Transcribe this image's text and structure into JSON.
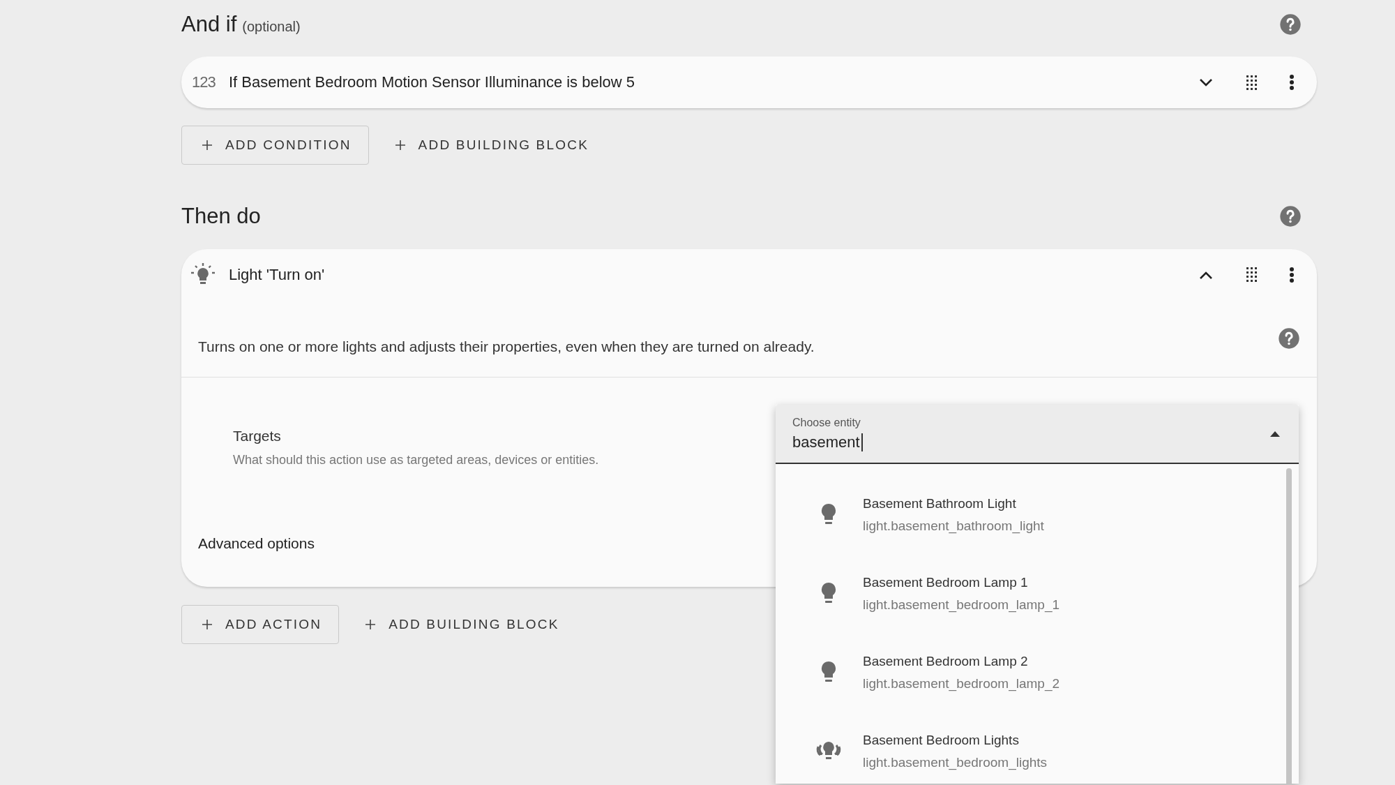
{
  "conditions_section": {
    "title": "And if",
    "note": "(optional)",
    "conditions": [
      {
        "icon_text": "123",
        "title": "If Basement Bedroom Motion Sensor Illuminance is below 5",
        "expanded": false
      }
    ],
    "buttons": [
      {
        "label": "ADD CONDITION",
        "kind": "outlined"
      },
      {
        "label": "ADD BUILDING BLOCK",
        "kind": "text"
      }
    ]
  },
  "actions_section": {
    "title": "Then do",
    "actions": [
      {
        "title": "Light 'Turn on'",
        "expanded": true,
        "description": "Turns on one or more lights and adjusts their properties, even when they are turned on already.",
        "targets_label": "Targets",
        "targets_hint": "What should this action use as targeted areas, devices or entities.",
        "advanced_label": "Advanced options"
      }
    ],
    "buttons": [
      {
        "label": "ADD ACTION",
        "kind": "outlined"
      },
      {
        "label": "ADD BUILDING BLOCK",
        "kind": "text"
      }
    ]
  },
  "entity_picker": {
    "label": "Choose entity",
    "value": "basement",
    "expanded": true,
    "options": [
      {
        "name": "Basement Bathroom Light",
        "entity_id": "light.basement_bathroom_light",
        "kind": "bulb"
      },
      {
        "name": "Basement Bedroom Lamp 1",
        "entity_id": "light.basement_bedroom_lamp_1",
        "kind": "bulb"
      },
      {
        "name": "Basement Bedroom Lamp 2",
        "entity_id": "light.basement_bedroom_lamp_2",
        "kind": "bulb"
      },
      {
        "name": "Basement Bedroom Lights",
        "entity_id": "light.basement_bedroom_lights",
        "kind": "group"
      }
    ]
  }
}
